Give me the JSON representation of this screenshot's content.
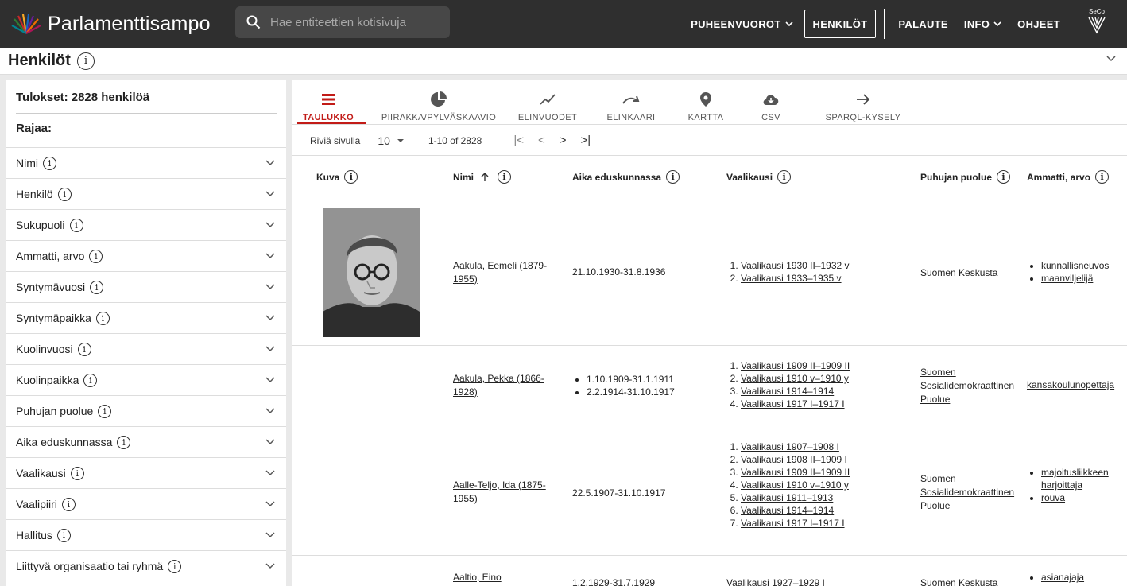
{
  "app": {
    "title": "Parlamenttisampo",
    "search_placeholder": "Hae entiteettien kotisivuja",
    "nav": {
      "puheenvuorot": "PUHEENVUOROT",
      "henkilot": "HENKILÖT",
      "palaute": "PALAUTE",
      "info": "INFO",
      "ohjeet": "OHJEET"
    },
    "seco_label": "SeCo"
  },
  "page": {
    "title": "Henkilöt"
  },
  "sidebar": {
    "results": "Tulokset: 2828 henkilöä",
    "rajaa": "Rajaa:",
    "facets": [
      "Nimi",
      "Henkilö",
      "Sukupuoli",
      "Ammatti, arvo",
      "Syntymävuosi",
      "Syntymäpaikka",
      "Kuolinvuosi",
      "Kuolinpaikka",
      "Puhujan puolue",
      "Aika eduskunnassa",
      "Vaalikausi",
      "Vaalipiiri",
      "Hallitus",
      "Liittyvä organisaatio tai ryhmä"
    ]
  },
  "tabs": [
    "TAULUKKO",
    "PIIRAKKA/PYLVÄSKAAVIO",
    "ELINVUODET",
    "ELINKAARI",
    "KARTTA",
    "CSV",
    "SPARQL-KYSELY"
  ],
  "pager": {
    "rows_label": "Riviä sivulla",
    "rows_value": "10",
    "range": "1-10 of 2828"
  },
  "table": {
    "headers": [
      "Kuva",
      "Nimi",
      "Aika eduskunnassa",
      "Vaalikausi",
      "Puhujan puolue",
      "Ammatti, arvo"
    ],
    "rows": [
      {
        "name": "Aakula, Eemeli (1879-1955)",
        "aika": [
          "21.10.1930-31.8.1936"
        ],
        "vaalikausi": [
          "Vaalikausi 1930 II–1932 v",
          "Vaalikausi 1933–1935 v"
        ],
        "puolue": "Suomen Keskusta",
        "ammatti": [
          "kunnallisneuvos",
          "maanviljelijä"
        ]
      },
      {
        "name": "Aakula, Pekka (1866-1928)",
        "aika": [
          "1.10.1909-31.1.1911",
          "2.2.1914-31.10.1917"
        ],
        "vaalikausi": [
          "Vaalikausi 1909 II–1909 II",
          "Vaalikausi 1910 v–1910 y",
          "Vaalikausi 1914–1914",
          "Vaalikausi 1917 I–1917 I"
        ],
        "puolue": "Suomen Sosialidemokraattinen Puolue",
        "ammatti": [
          "kansakoulunopettaja"
        ]
      },
      {
        "name": "Aalle-Teljo, Ida (1875-1955)",
        "aika": [
          "22.5.1907-31.10.1917"
        ],
        "vaalikausi": [
          "Vaalikausi 1907–1908 I",
          "Vaalikausi 1908 II–1909 I",
          "Vaalikausi 1909 II–1909 II",
          "Vaalikausi 1910 v–1910 y",
          "Vaalikausi 1911–1913",
          "Vaalikausi 1914–1914",
          "Vaalikausi 1917 I–1917 I"
        ],
        "puolue": "Suomen Sosialidemokraattinen Puolue",
        "ammatti": [
          "majoitusliikkeen harjoittaja",
          "rouva"
        ]
      },
      {
        "name": "Aaltio, Eino",
        "aika": [
          "1.2.1929-31.7.1929"
        ],
        "vaalikausi": [
          "Vaalikausi 1927–1929 I"
        ],
        "puolue": "Suomen Keskusta",
        "ammatti": [
          "asianajaja"
        ]
      }
    ]
  }
}
